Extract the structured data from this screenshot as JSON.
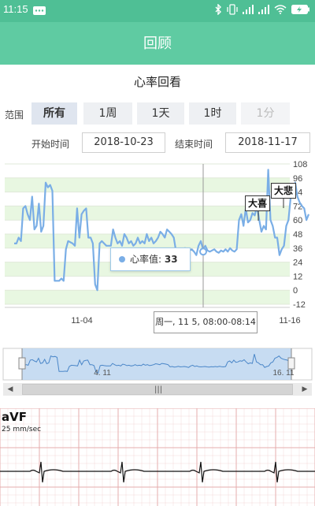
{
  "status_bar": {
    "time": "11:15",
    "battery_icon": "battery-charging-icon",
    "icons": [
      "message-icon",
      "bluetooth-icon",
      "vibrate-icon",
      "signal-icon",
      "signal-icon",
      "wifi-icon"
    ]
  },
  "app_bar": {
    "title": "回顾"
  },
  "page": {
    "subtitle": "心率回看"
  },
  "range": {
    "label": "范围",
    "options": [
      {
        "label": "所有",
        "state": "active"
      },
      {
        "label": "1周",
        "state": "normal"
      },
      {
        "label": "1天",
        "state": "normal"
      },
      {
        "label": "1时",
        "state": "normal"
      },
      {
        "label": "1分",
        "state": "disabled"
      }
    ]
  },
  "dates": {
    "start_label": "开始时间",
    "start_value": "2018-10-23",
    "end_label": "结束时间",
    "end_value": "2018-11-17"
  },
  "tooltip": {
    "label": "心率值:",
    "value": "33"
  },
  "crosshair_time": "周一, 11 5, 08:00-08:14",
  "flags": {
    "big_joy": "大喜",
    "big_sorrow": "大悲"
  },
  "navigator": {
    "labels": [
      "4. 11",
      "16. 11"
    ]
  },
  "ecg": {
    "lead": "aVF",
    "speed": "25 mm/sec"
  },
  "colors": {
    "accent": "#5fcba2",
    "status": "#4fbf95",
    "series": "#7aaee6",
    "band": "#e8f7e1",
    "ecg_grid": "#e4a6a6"
  },
  "chart_data": {
    "type": "line",
    "title": "",
    "xlabel": "",
    "ylabel": "",
    "x_ticks": [
      "11-04",
      "11-16"
    ],
    "y_ticks": [
      108,
      96,
      84,
      72,
      60,
      48,
      36,
      24,
      12,
      0,
      -12
    ],
    "ylim": [
      -12,
      108
    ],
    "grid": true,
    "series": [
      {
        "values": [
          40,
          40,
          45,
          42,
          70,
          72,
          65,
          60,
          80,
          52,
          55,
          74,
          50,
          55,
          92,
          88,
          90,
          85,
          8,
          8,
          8,
          10,
          8,
          35,
          42,
          41,
          40,
          38,
          70,
          45,
          65,
          68,
          70,
          45,
          45,
          40,
          5,
          0,
          40,
          42,
          40,
          38,
          38,
          38,
          52,
          45,
          40,
          42,
          38,
          48,
          45,
          40,
          42,
          38,
          40,
          45,
          40,
          42,
          40,
          48,
          42,
          45,
          40,
          42,
          45,
          50,
          48,
          45,
          52,
          50,
          48,
          45,
          33,
          35,
          32,
          33,
          36,
          33,
          34,
          35,
          33,
          30,
          38,
          42,
          35,
          38,
          34,
          33,
          34,
          35,
          33,
          32,
          34,
          33,
          35,
          33,
          36,
          34,
          33,
          35,
          60,
          65,
          55,
          70,
          58,
          60,
          66,
          64,
          72,
          60,
          50,
          55,
          52,
          103,
          60,
          55,
          45,
          45,
          30,
          35,
          38,
          55,
          60,
          80,
          85,
          92,
          80,
          75,
          72,
          70,
          60,
          65
        ]
      }
    ]
  }
}
